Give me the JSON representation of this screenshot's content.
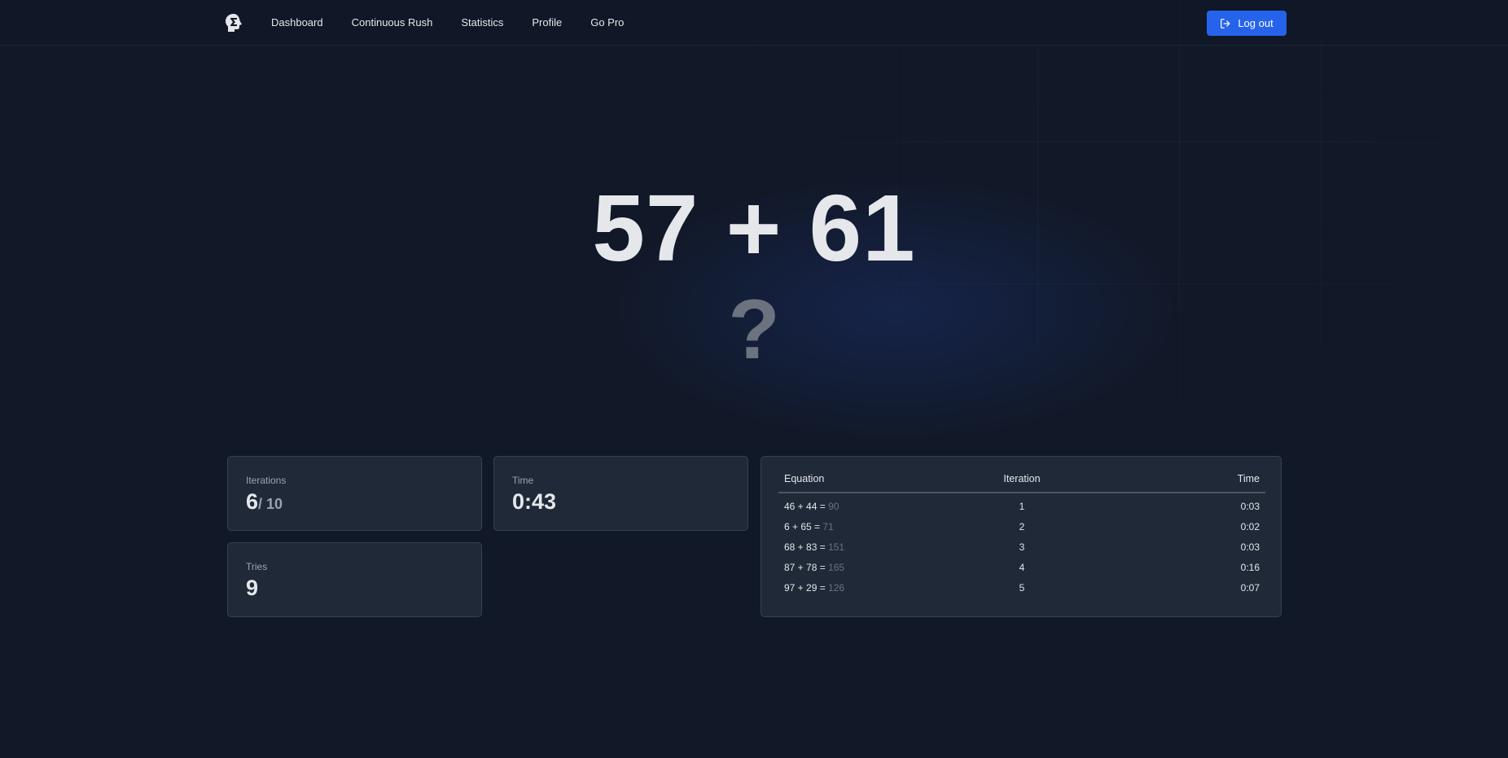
{
  "nav": {
    "links": [
      "Dashboard",
      "Continuous Rush",
      "Statistics",
      "Profile",
      "Go Pro"
    ],
    "logout_label": "Log out"
  },
  "game": {
    "problem": "57 + 61",
    "placeholder": "?"
  },
  "stats": {
    "iterations_label": "Iterations",
    "iterations_value": "6",
    "iterations_total": "/ 10",
    "time_label": "Time",
    "time_value": "0:43",
    "tries_label": "Tries",
    "tries_value": "9"
  },
  "history": {
    "headers": [
      "Equation",
      "Iteration",
      "Time"
    ],
    "rows": [
      {
        "equation": "46 + 44 =",
        "answer": "90",
        "iteration": "1",
        "time": "0:03"
      },
      {
        "equation": "6 + 65 =",
        "answer": "71",
        "iteration": "2",
        "time": "0:02"
      },
      {
        "equation": "68 + 83 =",
        "answer": "151",
        "iteration": "3",
        "time": "0:03"
      },
      {
        "equation": "87 + 78 =",
        "answer": "165",
        "iteration": "4",
        "time": "0:16"
      },
      {
        "equation": "97 + 29 =",
        "answer": "126",
        "iteration": "5",
        "time": "0:07"
      }
    ]
  },
  "colors": {
    "background": "#111827",
    "card": "#1f2937",
    "accent": "#2563eb",
    "muted": "#6b7280"
  }
}
